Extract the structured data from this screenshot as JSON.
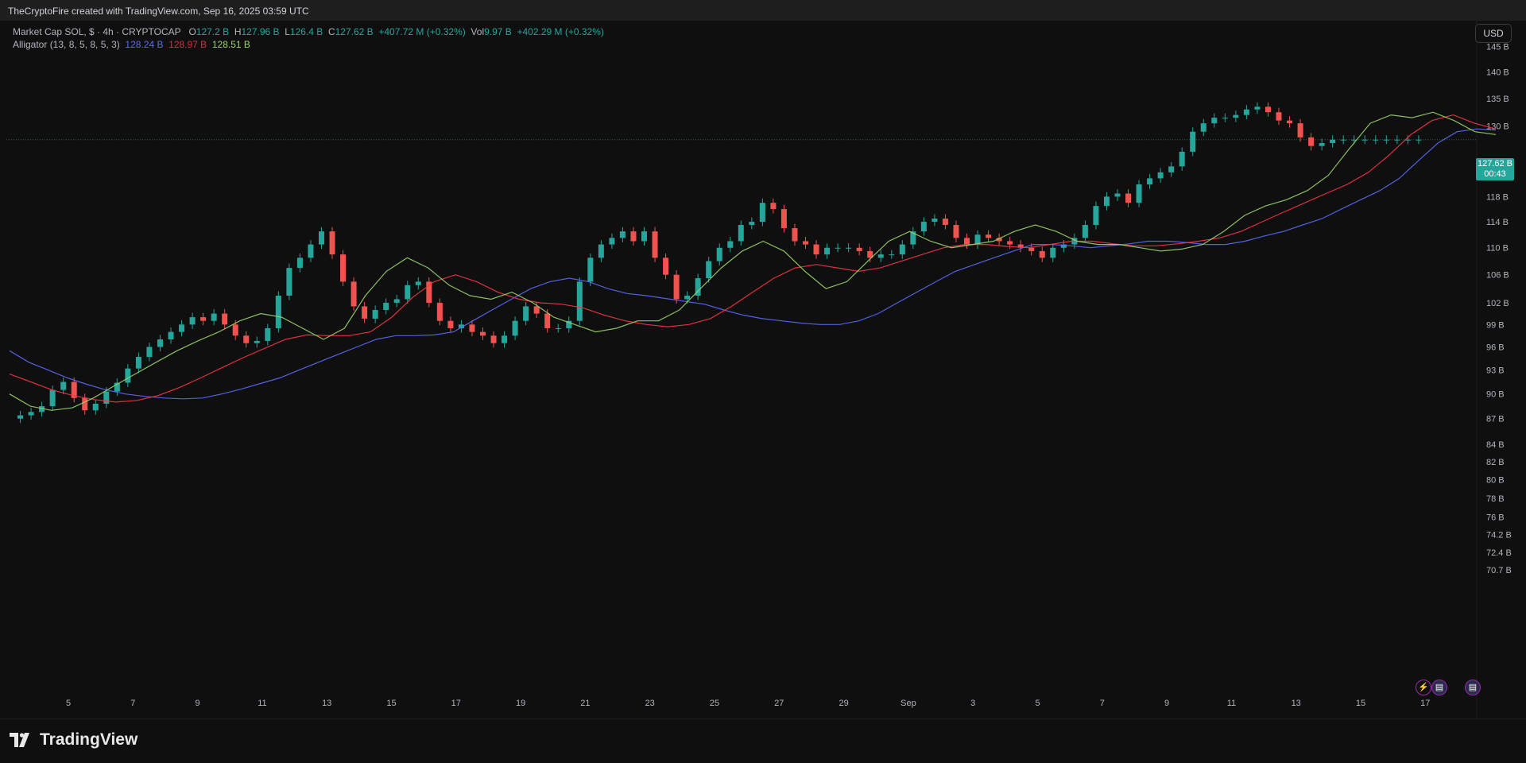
{
  "header": {
    "credit": "TheCryptoFire created with TradingView.com, Sep 16, 2025 03:59 UTC"
  },
  "legend": {
    "symbol": "Market Cap SOL, $ · 4h · CRYPTOCAP",
    "o_label": "O",
    "o": "127.2 B",
    "h_label": "H",
    "h": "127.96 B",
    "l_label": "L",
    "l": "126.4 B",
    "c_label": "C",
    "c": "127.62 B",
    "change": "+407.72 M (+0.32%)",
    "vol_label": "Vol",
    "vol": "9.97 B",
    "vol_change": "+402.29 M (+0.32%)",
    "indicator": "Alligator (13, 8, 5, 8, 5, 3)",
    "jaw": "128.24 B",
    "teeth": "128.97 B",
    "lips": "128.51 B"
  },
  "currency_button": "USD",
  "last_price": {
    "value": "127.62 B",
    "countdown": "00:43"
  },
  "brand": {
    "name": "TradingView"
  },
  "events": {
    "icon1": "lightning-icon",
    "icon2": "us-flag-icon",
    "icon3": "us-flag-icon"
  },
  "colors": {
    "background": "#0f0f0f",
    "up": "#26a69a",
    "down": "#ef5350",
    "jaw": "#5b6af5",
    "teeth": "#f23645",
    "lips": "#9ad36a"
  },
  "chart_data": {
    "type": "candlestick",
    "title": "Market Cap SOL, $ · 4h · CRYPTOCAP",
    "y_axis_labels": [
      "145 B",
      "140 B",
      "135 B",
      "130 B",
      "122 B",
      "118 B",
      "114 B",
      "110 B",
      "106 B",
      "102 B",
      "99 B",
      "96 B",
      "93 B",
      "90 B",
      "87 B",
      "84 B",
      "82 B",
      "80 B",
      "78 B",
      "76 B",
      "74.2 B",
      "72.4 B",
      "70.7 B"
    ],
    "x_axis_labels": [
      "5",
      "7",
      "9",
      "11",
      "13",
      "15",
      "17",
      "19",
      "21",
      "23",
      "25",
      "27",
      "29",
      "Sep",
      "3",
      "5",
      "7",
      "9",
      "11",
      "13",
      "15",
      "17"
    ],
    "ylim": [
      70,
      147
    ],
    "scale": "log",
    "close_path": {
      "x": [
        0,
        2,
        4,
        6,
        8,
        10,
        12,
        14,
        16,
        18,
        20,
        22,
        24,
        26,
        28,
        30,
        32,
        34,
        36,
        38,
        40,
        42,
        44,
        46,
        48,
        50,
        52,
        54,
        56,
        58,
        60,
        62,
        64,
        66,
        68,
        70,
        72,
        74,
        76,
        78,
        80,
        82,
        84,
        86,
        88,
        90,
        92,
        94,
        96,
        98,
        100,
        102,
        104,
        106,
        108,
        110,
        112,
        114,
        116,
        118,
        120,
        122,
        124,
        126,
        128,
        130,
        132,
        134,
        136,
        138,
        140,
        142,
        144,
        146,
        148,
        150,
        152,
        154,
        156,
        158,
        160,
        162,
        164,
        166,
        168,
        170,
        172,
        174,
        176,
        178,
        180,
        182,
        184,
        186,
        188,
        190,
        192,
        194,
        196,
        198,
        200,
        202,
        204,
        206,
        208,
        210,
        212,
        214,
        216,
        218,
        220,
        222,
        224,
        226,
        228,
        230,
        232,
        234,
        236,
        238,
        240,
        242,
        244,
        246,
        248,
        250,
        252,
        254,
        256,
        258,
        260,
        262,
        264,
        266
      ],
      "close": [
        87.0,
        87.4,
        87.8,
        88.5,
        90.5,
        91.5,
        89.5,
        88.0,
        88.8,
        90.3,
        91.4,
        93.2,
        94.7,
        96.0,
        97.0,
        98.0,
        99.0,
        100.0,
        99.5,
        100.5,
        99.0,
        97.5,
        96.5,
        96.8,
        98.5,
        103.0,
        107.0,
        108.5,
        110.5,
        112.5,
        109.0,
        105.0,
        101.5,
        99.8,
        101.0,
        102.0,
        102.5,
        104.5,
        105.0,
        102.0,
        99.5,
        98.5,
        99.0,
        98.0,
        97.5,
        96.5,
        97.5,
        99.5,
        101.5,
        100.5,
        98.5,
        98.5,
        99.5,
        105.0,
        108.5,
        110.5,
        111.5,
        112.5,
        111.0,
        112.5,
        108.5,
        106.0,
        102.5,
        103.0,
        105.5,
        108.0,
        110.0,
        111.0,
        113.5,
        114.0,
        117.0,
        116.0,
        113.0,
        111.0,
        110.5,
        109.0,
        110.0,
        110.0,
        110.0,
        109.5,
        108.5,
        109.0,
        109.0,
        110.5,
        112.5,
        114.0,
        114.5,
        113.5,
        111.5,
        110.5,
        112.0,
        111.5,
        111.0,
        110.5,
        110.0,
        109.5,
        108.5,
        110.0,
        110.5,
        111.5,
        113.5,
        116.5,
        118.0,
        118.5,
        117.0,
        120.0,
        121.0,
        122.0,
        123.0,
        125.5,
        129.0,
        130.5,
        131.5,
        131.5,
        132.0,
        133.0,
        133.5,
        132.5,
        131.0,
        130.5,
        128.0,
        126.5,
        127.0,
        127.6,
        127.6,
        127.6,
        127.6,
        127.6,
        127.6,
        127.6,
        127.6,
        127.6
      ]
    },
    "alligator": {
      "jaw_path": [
        95.5,
        94.0,
        93.0,
        92.0,
        91.2,
        90.5,
        90.0,
        89.7,
        89.5,
        89.4,
        89.5,
        90.0,
        90.6,
        91.3,
        92.0,
        93.0,
        94.0,
        95.0,
        96.0,
        97.0,
        97.5,
        97.5,
        97.6,
        98.0,
        99.5,
        101.0,
        102.5,
        104.0,
        105.0,
        105.5,
        105.0,
        104.0,
        103.3,
        103.0,
        102.6,
        102.2,
        101.8,
        101.0,
        100.3,
        99.8,
        99.5,
        99.2,
        99.0,
        99.0,
        99.5,
        100.5,
        102.0,
        103.5,
        105.0,
        106.5,
        107.5,
        108.5,
        109.5,
        110.5,
        110.5,
        110.3,
        110.0,
        110.3,
        110.6,
        111.0,
        111.0,
        110.8,
        110.5,
        110.5,
        111.0,
        111.8,
        112.5,
        113.5,
        114.5,
        116.0,
        117.5,
        119.0,
        121.0,
        124.0,
        127.0,
        129.0,
        129.5,
        129.3
      ],
      "teeth_path": [
        92.5,
        91.5,
        90.5,
        89.8,
        89.3,
        89.0,
        89.2,
        89.8,
        90.8,
        92.0,
        93.3,
        94.6,
        95.8,
        97.0,
        97.6,
        97.5,
        97.5,
        98.0,
        100.0,
        102.8,
        105.0,
        106.0,
        105.0,
        103.5,
        102.5,
        102.0,
        101.8,
        101.3,
        100.3,
        99.5,
        99.0,
        98.7,
        99.0,
        99.8,
        101.5,
        103.5,
        105.5,
        107.0,
        107.5,
        107.0,
        106.5,
        107.0,
        108.0,
        109.0,
        110.0,
        110.5,
        110.5,
        110.2,
        110.0,
        110.5,
        111.0,
        111.0,
        110.6,
        110.3,
        110.3,
        110.6,
        111.0,
        111.5,
        112.5,
        114.0,
        115.5,
        117.0,
        118.5,
        120.0,
        122.0,
        125.0,
        128.5,
        131.0,
        132.0,
        130.5,
        129.5
      ],
      "lips_path": [
        90.0,
        88.5,
        88.0,
        88.3,
        89.5,
        91.0,
        92.5,
        94.0,
        95.5,
        96.8,
        98.0,
        99.5,
        100.5,
        100.0,
        98.5,
        97.0,
        98.5,
        103.0,
        106.5,
        108.5,
        107.0,
        104.5,
        103.0,
        102.5,
        103.5,
        102.0,
        100.0,
        99.0,
        98.0,
        98.5,
        99.5,
        99.5,
        101.0,
        104.0,
        107.0,
        109.5,
        111.0,
        109.5,
        106.5,
        104.0,
        105.0,
        108.0,
        111.0,
        112.5,
        111.0,
        110.0,
        110.5,
        111.0,
        112.5,
        113.5,
        112.5,
        111.0,
        110.5,
        110.5,
        110.0,
        109.5,
        109.8,
        110.5,
        112.5,
        115.0,
        116.5,
        117.5,
        119.0,
        121.5,
        126.0,
        130.5,
        132.0,
        131.5,
        132.5,
        131.0,
        129.0,
        128.5
      ]
    }
  }
}
